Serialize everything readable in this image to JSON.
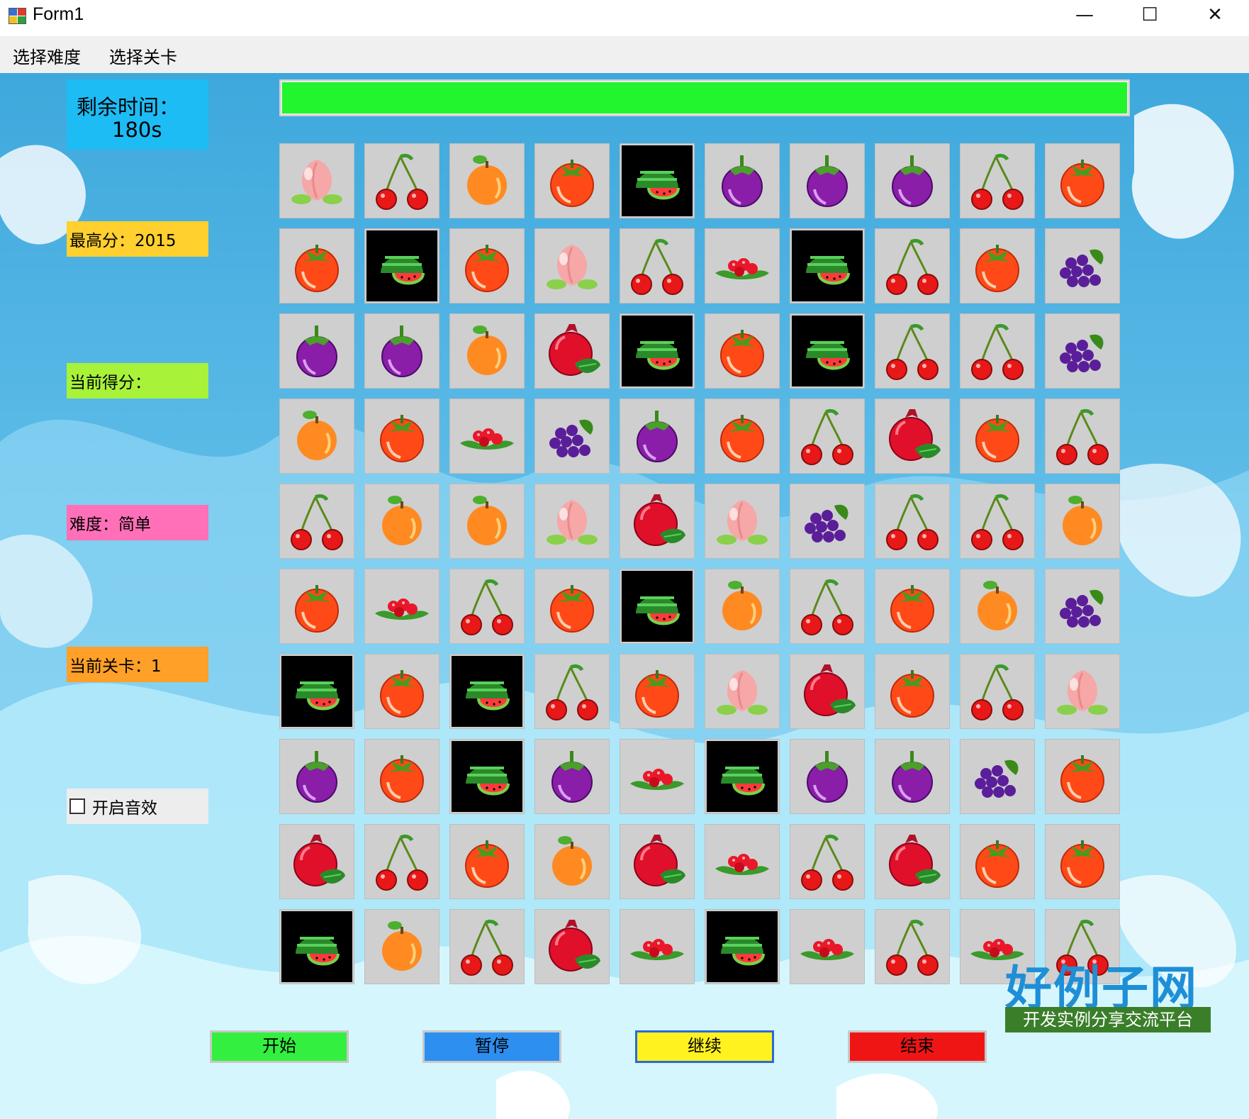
{
  "window": {
    "title": "Form1",
    "minimize_glyph": "—",
    "maximize_glyph": "☐",
    "close_glyph": "✕"
  },
  "menu": {
    "items": [
      {
        "label": "选择难度"
      },
      {
        "label": "选择关卡"
      }
    ]
  },
  "panels": {
    "time_label": "剩余时间：",
    "time_value": "180s",
    "high_score": "最高分：2015",
    "current_score": "当前得分：",
    "difficulty": "难度：简单",
    "level": "当前关卡：1",
    "sound_label": "开启音效",
    "sound_checked": false
  },
  "progress": {
    "fraction": 1.0,
    "color": "#22f52e"
  },
  "colors": {
    "time_panel": "#1ebcf5",
    "high_score_panel": "#ffd02e",
    "current_score_panel": "#a8f23a",
    "difficulty_panel": "#ff70b8",
    "level_panel": "#ffa028",
    "start_button": "#33f040",
    "pause_button": "#2d8ff0",
    "continue_button": "#fff21e",
    "end_button": "#f01515"
  },
  "board": {
    "rows": 10,
    "cols": 10,
    "tiles": [
      [
        "peach",
        "cherry",
        "orange",
        "tomato",
        "watermelon",
        "mangosteen",
        "mangosteen",
        "mangosteen",
        "cherry",
        "tomato"
      ],
      [
        "tomato",
        "watermelon",
        "tomato",
        "peach",
        "cherry",
        "raspberry",
        "watermelon",
        "cherry",
        "tomato",
        "grape"
      ],
      [
        "mangosteen",
        "mangosteen",
        "orange",
        "pomegranate",
        "watermelon",
        "tomato",
        "watermelon",
        "cherry",
        "cherry",
        "grape"
      ],
      [
        "orange",
        "tomato",
        "raspberry",
        "grape",
        "mangosteen",
        "tomato",
        "cherry",
        "pomegranate",
        "tomato",
        "cherry"
      ],
      [
        "cherry",
        "orange",
        "orange",
        "peach",
        "pomegranate",
        "peach",
        "grape",
        "cherry",
        "cherry",
        "orange"
      ],
      [
        "tomato",
        "raspberry",
        "cherry",
        "tomato",
        "watermelon",
        "orange",
        "cherry",
        "tomato",
        "orange",
        "grape"
      ],
      [
        "watermelon",
        "tomato",
        "watermelon",
        "cherry",
        "tomato",
        "peach",
        "pomegranate",
        "tomato",
        "cherry",
        "peach"
      ],
      [
        "mangosteen",
        "tomato",
        "watermelon",
        "mangosteen",
        "raspberry",
        "watermelon",
        "mangosteen",
        "mangosteen",
        "grape",
        "tomato"
      ],
      [
        "pomegranate",
        "cherry",
        "tomato",
        "orange",
        "pomegranate",
        "raspberry",
        "cherry",
        "pomegranate",
        "tomato",
        "tomato"
      ],
      [
        "watermelon",
        "orange",
        "cherry",
        "pomegranate",
        "raspberry",
        "watermelon",
        "raspberry",
        "cherry",
        "raspberry",
        "cherry"
      ]
    ]
  },
  "controls": {
    "start": "开始",
    "pause": "暂停",
    "continue": "继续",
    "end": "结束"
  },
  "brand": {
    "name": "好例子网",
    "slogan": "开发实例分享交流平台"
  }
}
